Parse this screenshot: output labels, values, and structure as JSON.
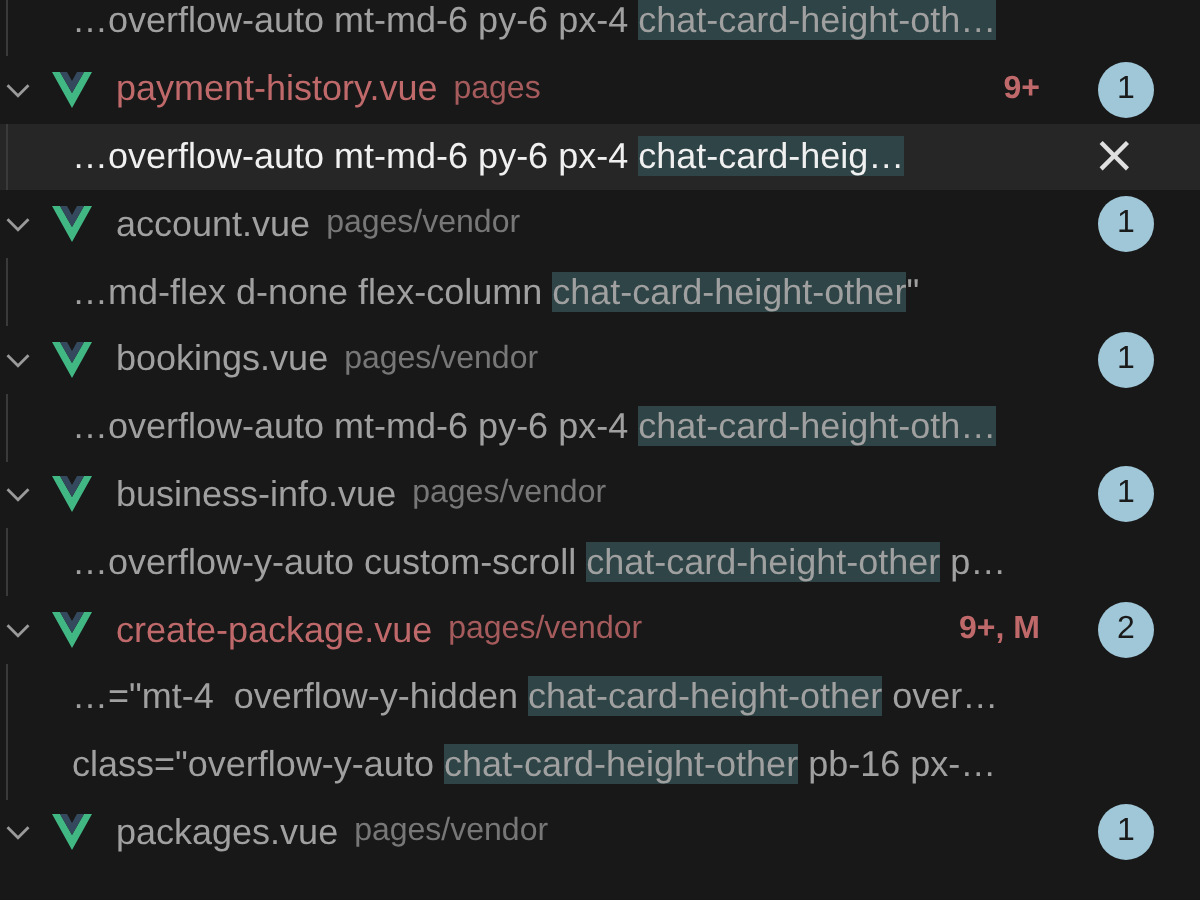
{
  "leading_matches": [
    {
      "prefix": "…overflow-auto mt-md-6 py-6 px-4 ",
      "highlight": "chat-card-height-oth…",
      "selected": false
    }
  ],
  "files": [
    {
      "name": "payment-history.vue",
      "path": "pages",
      "modified": true,
      "decoration": "9+",
      "count": "1",
      "expanded": true,
      "matches": [
        {
          "prefix": "…overflow-auto mt-md-6 py-6 px-4 ",
          "highlight": "chat-card-heig…",
          "selected": true,
          "dismiss": "×"
        }
      ]
    },
    {
      "name": "account.vue",
      "path": "pages/vendor",
      "modified": false,
      "count": "1",
      "expanded": true,
      "matches": [
        {
          "prefix": "…md-flex d-none flex-column ",
          "highlight": "chat-card-height-other",
          "suffix": "\"",
          "selected": false
        }
      ]
    },
    {
      "name": "bookings.vue",
      "path": "pages/vendor",
      "modified": false,
      "count": "1",
      "expanded": true,
      "matches": [
        {
          "prefix": "…overflow-auto mt-md-6 py-6 px-4 ",
          "highlight": "chat-card-height-oth…",
          "selected": false
        }
      ]
    },
    {
      "name": "business-info.vue",
      "path": "pages/vendor",
      "modified": false,
      "count": "1",
      "expanded": true,
      "matches": [
        {
          "prefix": "…overflow-y-auto custom-scroll ",
          "highlight": "chat-card-height-other",
          "suffix": " p…",
          "selected": false
        }
      ]
    },
    {
      "name": "create-package.vue",
      "path": "pages/vendor",
      "modified": true,
      "decoration": "9+, M",
      "count": "2",
      "expanded": true,
      "matches": [
        {
          "prefix": "…=\"mt-4  overflow-y-hidden ",
          "highlight": "chat-card-height-other",
          "suffix": " over…",
          "selected": false
        },
        {
          "prefix": "class=\"overflow-y-auto ",
          "highlight": "chat-card-height-other",
          "suffix": " pb-16 px-…",
          "selected": false
        }
      ]
    },
    {
      "name": "packages.vue",
      "path": "pages/vendor",
      "modified": false,
      "count": "1",
      "expanded": true
    }
  ]
}
